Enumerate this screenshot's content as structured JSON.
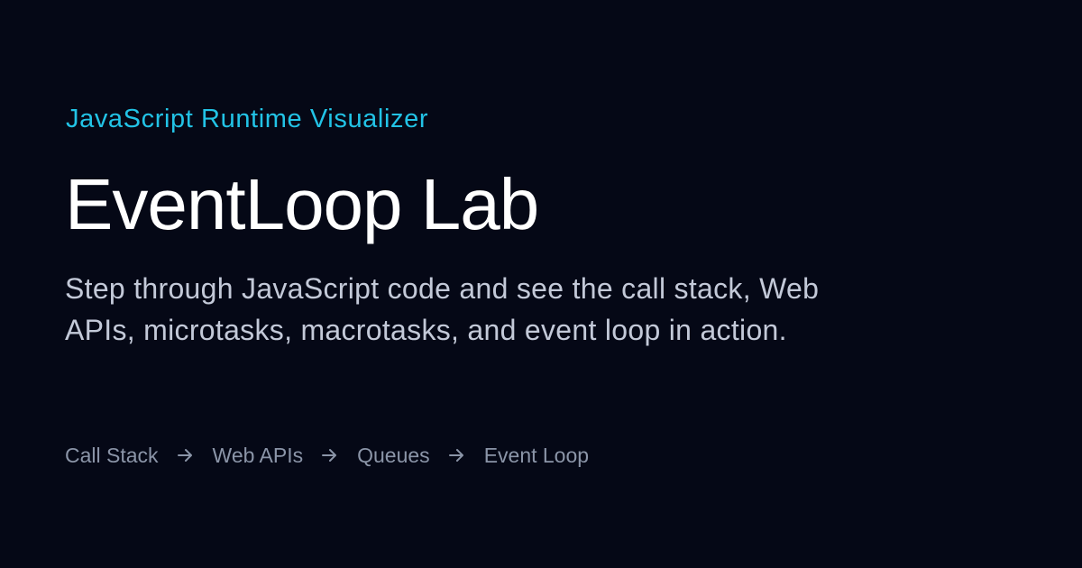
{
  "hero": {
    "eyebrow": "JavaScript Runtime Visualizer",
    "title": "EventLoop Lab",
    "description": "Step through JavaScript code and see the call stack, Web APIs, microtasks, macrotasks, and event loop in action."
  },
  "flow": {
    "steps": [
      "Call Stack",
      "Web APIs",
      "Queues",
      "Event Loop"
    ],
    "separator_icon": "arrow-right-icon"
  },
  "colors": {
    "background": "#050816",
    "accent": "#22c3e6",
    "title": "#ffffff",
    "description": "#c3c9d8",
    "flow": "#8b95a8"
  }
}
